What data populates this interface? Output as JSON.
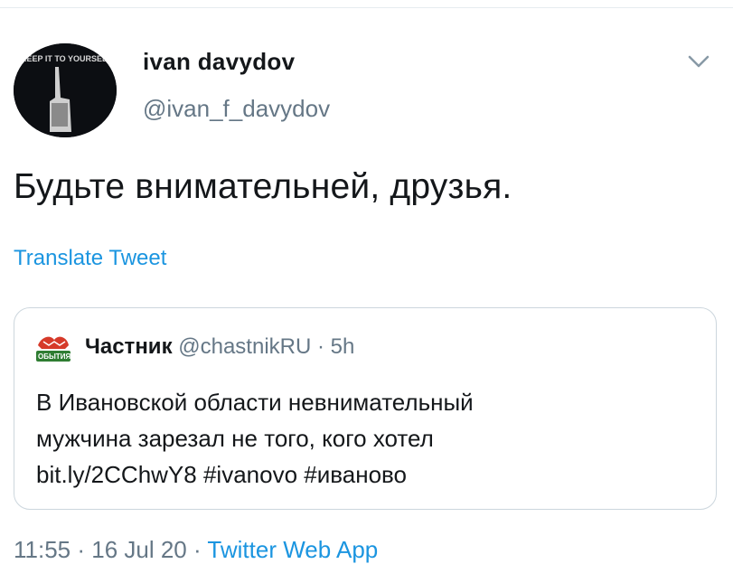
{
  "author": {
    "name": "ivan davydov",
    "handle": "@ivan_f_davydov",
    "avatar_text": "KEEP IT TO YOURSELF BUDDY"
  },
  "tweet": {
    "text": "Будьте внимательней, друзья.",
    "translate_label": "Translate Tweet"
  },
  "quoted": {
    "name": "Частник",
    "handle": "@chastnikRU",
    "separator": "·",
    "time": "5h",
    "avatar_text": "ОБЫТИЯ",
    "lines": [
      "В Ивановской области невнимательный",
      "мужчина зарезал не того, кого хотел",
      "bit.ly/2CChwY8 #ivanovo #иваново"
    ]
  },
  "meta": {
    "time": "11:55 · 16 Jul 20 ·",
    "app": "Twitter Web App"
  },
  "colors": {
    "link": "#1b95e0",
    "secondary": "#657786",
    "border": "#ccd6dd"
  }
}
